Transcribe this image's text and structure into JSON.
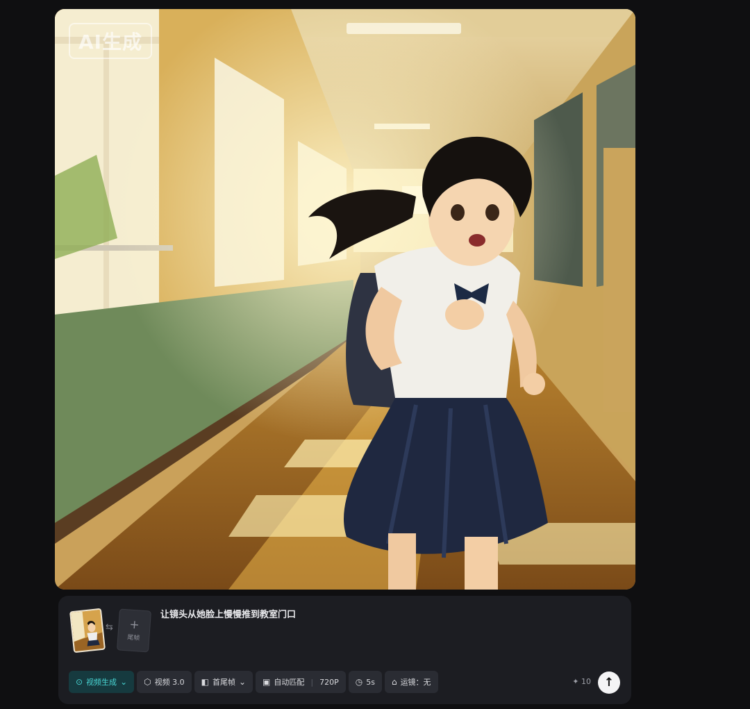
{
  "image": {
    "badge": "AI生成"
  },
  "composer": {
    "prompt": "让镜头从她脸上慢慢推到教室门口",
    "first_frame_icon": "thumbnail-image",
    "swap_icon": "swap-arrows-icon",
    "last_frame": {
      "plus": "+",
      "label": "尾帧"
    },
    "toolbar": {
      "mode": {
        "icon": "video-generate-icon",
        "label": "视频生成",
        "chevron": "⌄"
      },
      "model": {
        "icon": "cube-icon",
        "label": "视频 3.0"
      },
      "frames": {
        "icon": "frame-icon",
        "label": "首尾帧",
        "chevron": "⌄"
      },
      "ratio": {
        "icon": "aspect-ratio-icon",
        "label": "自动匹配",
        "resolution": "720P"
      },
      "duration": {
        "icon": "clock-icon",
        "label": "5s"
      },
      "camera": {
        "icon": "camera-icon",
        "label": "运镜：无"
      }
    },
    "credits": {
      "icon": "sparkle-icon",
      "value": "10"
    },
    "send_icon": "arrow-up-icon"
  },
  "colors": {
    "background": "#0f0f11",
    "panel": "#1c1d22",
    "chip": "#2a2c33",
    "accent": "#49d6d4"
  }
}
